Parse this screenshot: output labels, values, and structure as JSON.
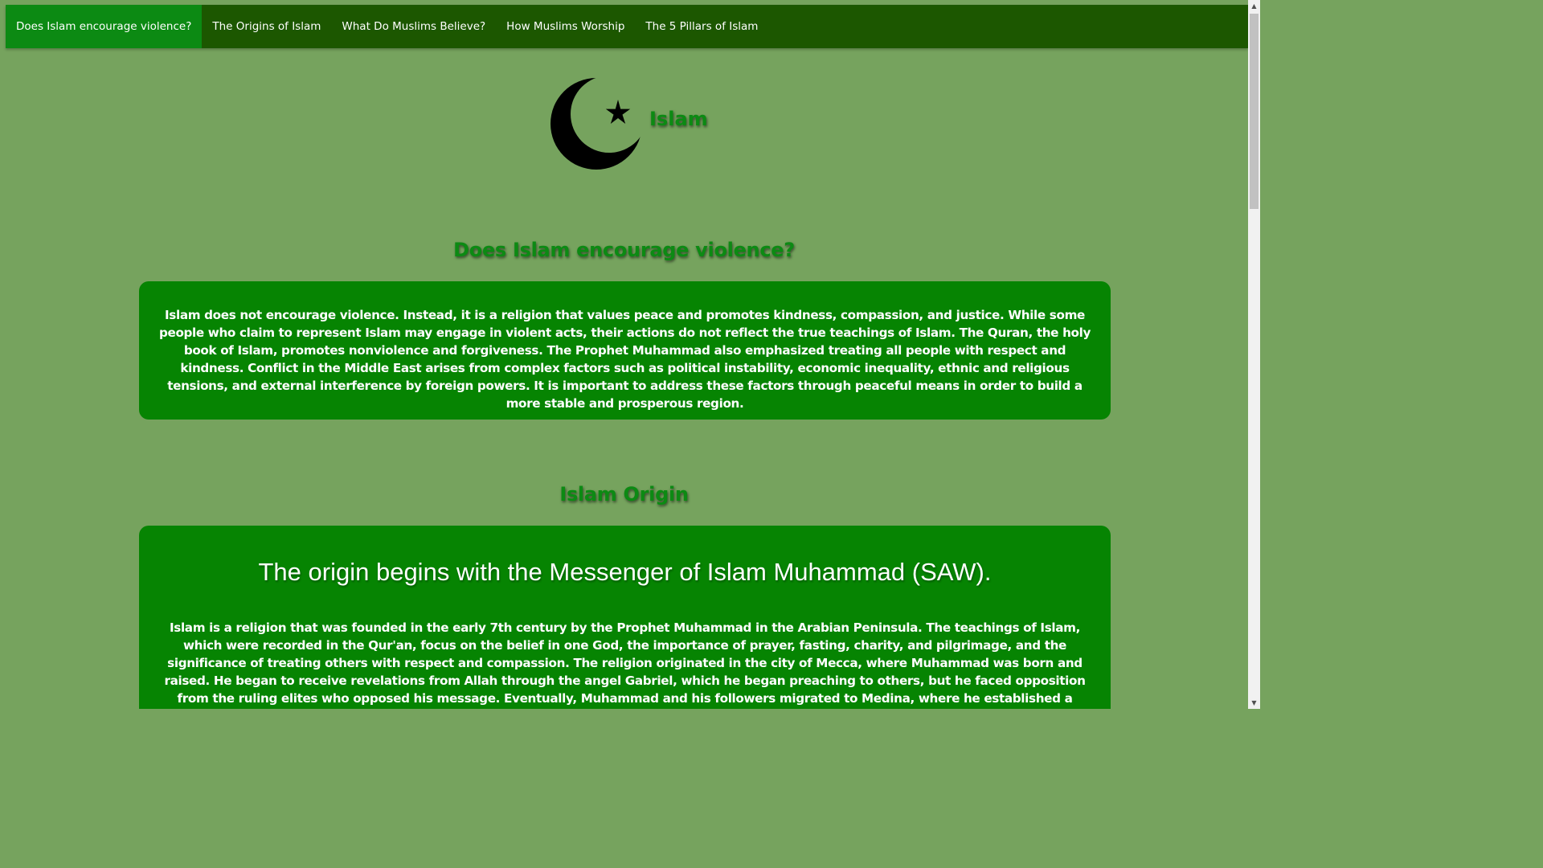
{
  "nav": {
    "items": [
      {
        "label": "Does Islam encourage violence?",
        "active": true
      },
      {
        "label": "The Origins of Islam",
        "active": false
      },
      {
        "label": "What Do Muslims Believe?",
        "active": false
      },
      {
        "label": "How Muslims Worship",
        "active": false
      },
      {
        "label": "The 5 Pillars of Islam",
        "active": false
      }
    ]
  },
  "header": {
    "logo_icon": "crescent-star-icon",
    "title": "Islam"
  },
  "violence_section": {
    "heading": "Does Islam encourage violence?",
    "body": "Islam does not encourage violence. Instead, it is a religion that values peace and promotes kindness, compassion, and justice. While some people who claim to represent Islam may engage in violent acts, their actions do not reflect the true teachings of Islam. The Quran, the holy book of Islam, promotes nonviolence and forgiveness. The Prophet Muhammad also emphasized treating all people with respect and kindness. Conflict in the Middle East arises from complex factors such as political instability, economic inequality, ethnic and religious tensions, and external interference by foreign powers. It is important to address these factors through peaceful means in order to build a more stable and prosperous region."
  },
  "origin_section": {
    "heading": "Islam Origin",
    "subheading": "The origin begins with the Messenger of Islam Muhammad (SAW).",
    "body": "Islam is a religion that was founded in the early 7th century by the Prophet Muhammad in the Arabian Peninsula. The teachings of Islam, which were recorded in the Qur'an, focus on the belief in one God, the importance of prayer, fasting, charity, and pilgrimage, and the significance of treating others with respect and compassion. The religion originated in the city of Mecca, where Muhammad was born and raised. He began to receive revelations from Allah through the angel Gabriel, which he began preaching to others, but he faced opposition from the ruling elites who opposed his message. Eventually, Muhammad and his followers migrated to Medina, where he established a community of believers, and continued to spread his teachings. The religion spread rapidly throughout Arabia and"
  },
  "colors": {
    "page_background": "#76a35e",
    "navbar": "#1c5700",
    "nav_active": "#0c8a13",
    "card": "#068402",
    "heading": "#0c8a13"
  }
}
